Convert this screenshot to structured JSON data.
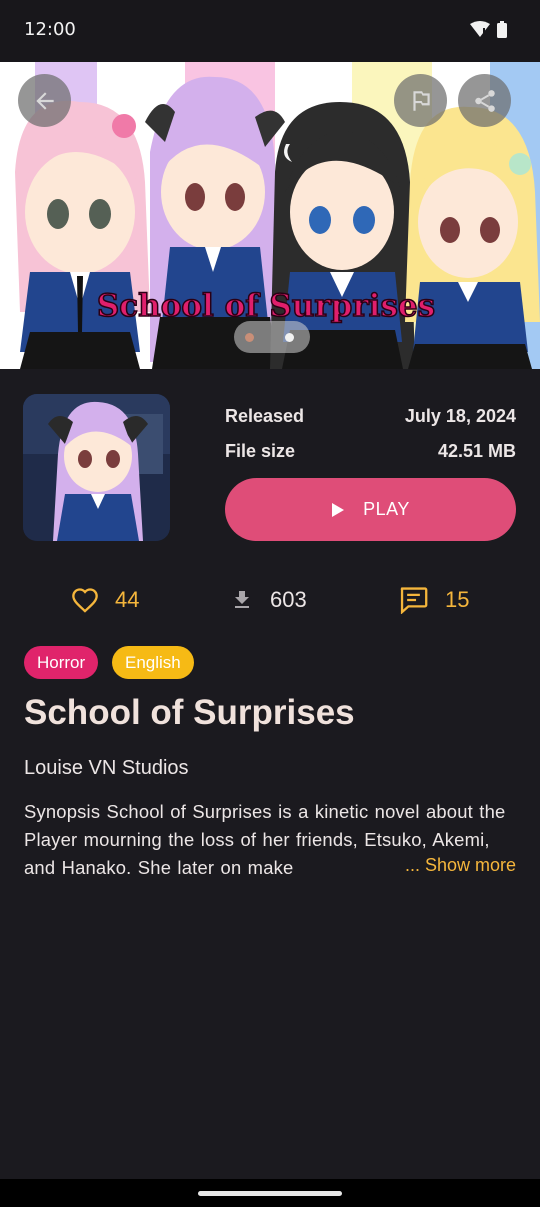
{
  "status_bar": {
    "time": "12:00",
    "icons": [
      "wifi-icon",
      "signal-icon",
      "battery-icon"
    ]
  },
  "header": {
    "back_icon": "arrow-left-icon",
    "report_icon": "flag-icon",
    "share_icon": "share-icon",
    "banner_title": "School of Surprises",
    "carousel_pages": 2,
    "carousel_active": 1
  },
  "info": {
    "released_label": "Released",
    "released_value": "July 18, 2024",
    "filesize_label": "File size",
    "filesize_value": "42.51 MB"
  },
  "play_button": {
    "label": "PLAY",
    "icon": "play-icon"
  },
  "stats": {
    "likes": "44",
    "downloads": "603",
    "comments": "15"
  },
  "tags": [
    "Horror",
    "English"
  ],
  "game": {
    "title": "School of Surprises",
    "author": "Louise VN Studios",
    "synopsis": "Synopsis School of Surprises is a kinetic novel about the Player mourning the loss of her friends, Etsuko, Akemi, and Hanako. She later on make",
    "show_more": "... Show more"
  },
  "colors": {
    "background": "#1b1a1f",
    "accent_pink": "#df4d78",
    "accent_yellow": "#f5b63c",
    "tag_horror": "#e0246b",
    "tag_english": "#f6ba15"
  }
}
